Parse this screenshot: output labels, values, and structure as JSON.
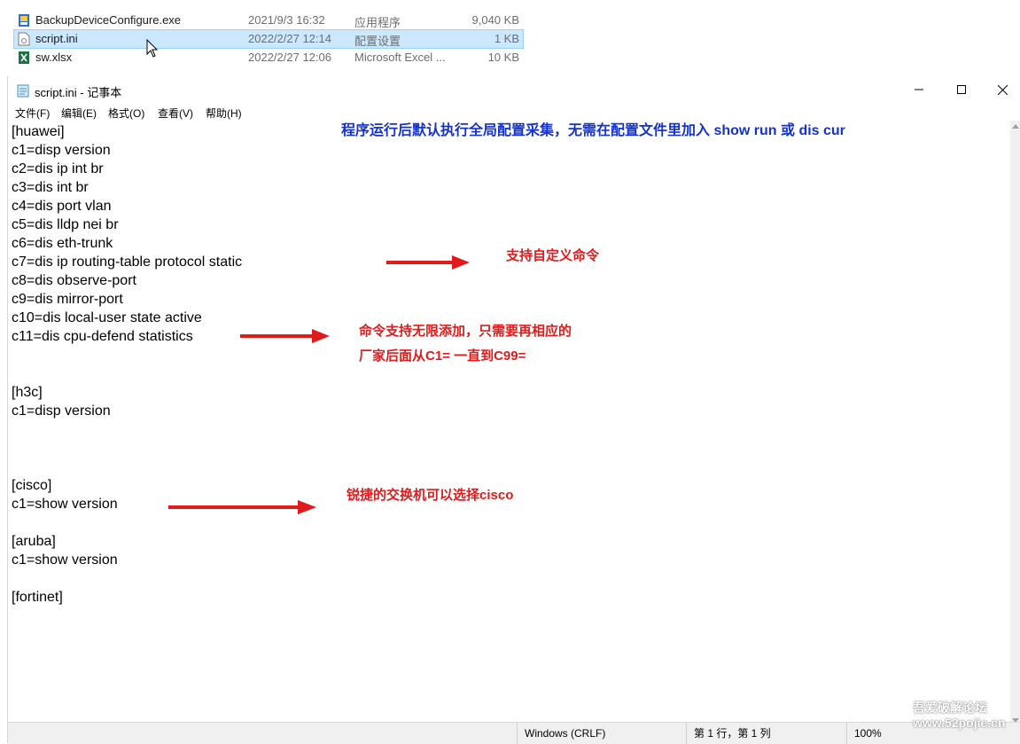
{
  "explorer": {
    "files": [
      {
        "name": "BackupDeviceConfigure.exe",
        "date": "2021/9/3 16:32",
        "type": "应用程序",
        "size": "9,040 KB",
        "icon": "exe-icon",
        "selected": false
      },
      {
        "name": "script.ini",
        "date": "2022/2/27 12:14",
        "type": "配置设置",
        "size": "1 KB",
        "icon": "ini-file-icon",
        "selected": true
      },
      {
        "name": "sw.xlsx",
        "date": "2022/2/27 12:06",
        "type": "Microsoft Excel ...",
        "size": "10 KB",
        "icon": "excel-icon",
        "selected": false
      }
    ]
  },
  "notepad": {
    "title": "script.ini - 记事本",
    "menu": [
      "文件(F)",
      "编辑(E)",
      "格式(O)",
      "查看(V)",
      "帮助(H)"
    ],
    "lines": [
      "[huawei]",
      "c1=disp version",
      "c2=dis ip int br",
      "c3=dis int br",
      "c4=dis port vlan",
      "c5=dis lldp nei br",
      "c6=dis eth-trunk",
      "c7=dis ip routing-table protocol static",
      "c8=dis observe-port",
      "c9=dis mirror-port",
      "c10=dis local-user state active",
      "c11=dis cpu-defend statistics",
      "",
      "",
      "[h3c]",
      "c1=disp version",
      "",
      "",
      "",
      "[cisco]",
      "c1=show version",
      "",
      "[aruba]",
      "c1=show version",
      "",
      "[fortinet]"
    ],
    "status": {
      "encoding": "Windows (CRLF)",
      "position": "第 1 行，第 1 列",
      "zoom": "100%"
    }
  },
  "annotations": {
    "top_note": "程序运行后默认执行全局配置采集，无需在配置文件里加入 show run 或 dis cur",
    "custom_cmd": "支持自定义命令",
    "unlimited_line1": "命令支持无限添加，只需要再相应的",
    "unlimited_line2": "厂家后面从C1= 一直到C99=",
    "ruijie": "锐捷的交换机可以选择cisco",
    "blue_color": "#1533c8",
    "red_color": "#e11b1b"
  },
  "watermark": {
    "line1": "吾爱破解论坛",
    "line2": "www.52pojie.cn"
  }
}
